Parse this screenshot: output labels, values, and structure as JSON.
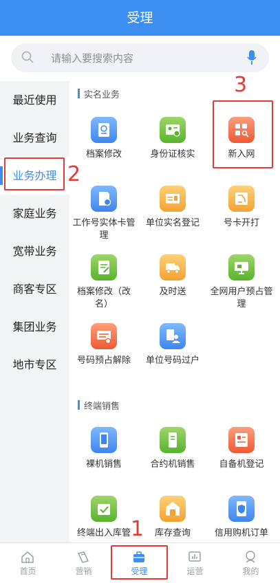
{
  "header": {
    "title": "受理"
  },
  "search": {
    "placeholder": "请输入要搜索内容"
  },
  "sidebar": {
    "items": [
      {
        "label": "最近使用"
      },
      {
        "label": "业务查询"
      },
      {
        "label": "业务办理",
        "active": true
      },
      {
        "label": "家庭业务"
      },
      {
        "label": "宽带业务"
      },
      {
        "label": "商客专区"
      },
      {
        "label": "集团业务"
      },
      {
        "label": "地市专区"
      }
    ]
  },
  "sections": {
    "realname": {
      "title": "实名业务",
      "tiles": [
        {
          "label": "档案修改",
          "icon": "file-edit-icon"
        },
        {
          "label": "身份证核实",
          "icon": "id-card-check-icon"
        },
        {
          "label": "新入网",
          "icon": "new-network-icon"
        },
        {
          "label": "工作号实体卡管理",
          "icon": "sim-card-settings-icon"
        },
        {
          "label": "单位实名登记",
          "icon": "company-card-icon"
        },
        {
          "label": "号卡开打",
          "icon": "card-open-icon"
        },
        {
          "label": "档案修改（改名）",
          "icon": "file-rename-icon"
        },
        {
          "label": "及时送",
          "icon": "delivery-truck-icon"
        },
        {
          "label": "全网用户预占管理",
          "icon": "monitor-icon"
        },
        {
          "label": "号码预占解除",
          "icon": "number-release-icon"
        },
        {
          "label": "单位号码过户",
          "icon": "number-transfer-icon"
        }
      ]
    },
    "terminal": {
      "title": "终端销售",
      "tiles": [
        {
          "label": "裸机销售",
          "icon": "phone-icon"
        },
        {
          "label": "合约机销售",
          "icon": "contract-phone-icon"
        },
        {
          "label": "自备机登记",
          "icon": "register-form-icon"
        },
        {
          "label": "终端出入库管",
          "icon": "box-check-icon"
        },
        {
          "label": "库存查询",
          "icon": "warehouse-icon"
        },
        {
          "label": "信用购机订单",
          "icon": "credit-shield-icon"
        }
      ]
    }
  },
  "tabbar": {
    "tabs": [
      {
        "label": "首页",
        "icon": "home-icon"
      },
      {
        "label": "营销",
        "icon": "marketing-icon"
      },
      {
        "label": "受理",
        "icon": "briefcase-icon",
        "active": true
      },
      {
        "label": "运营",
        "icon": "chart-icon"
      },
      {
        "label": "我的",
        "icon": "profile-icon"
      }
    ]
  },
  "annotations": {
    "n1": "1",
    "n2": "2",
    "n3": "3"
  },
  "colors": {
    "accent": "#3d8ef1",
    "annotation": "#e53935"
  }
}
